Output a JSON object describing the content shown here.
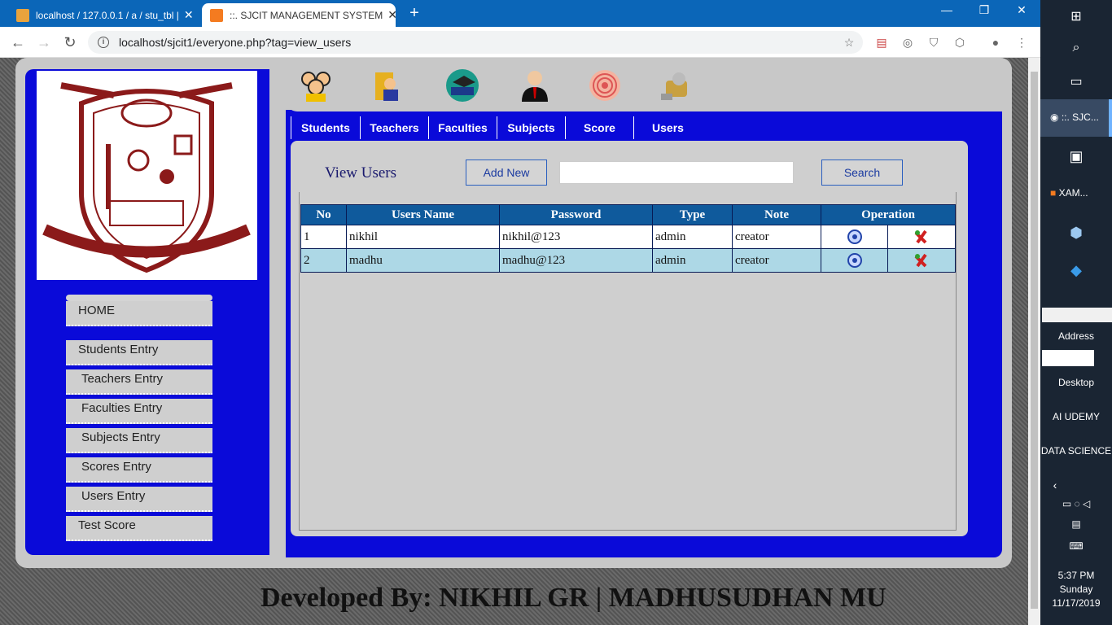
{
  "browser": {
    "tabs": [
      {
        "title": "localhost / 127.0.0.1 / a / stu_tbl |",
        "active": false
      },
      {
        "title": "::. SJCIT MANAGEMENT SYSTEM",
        "active": true
      }
    ],
    "new_tab": "+",
    "url": "localhost/sjcit1/everyone.php?tag=view_users",
    "window_controls": {
      "minimize": "—",
      "restore": "❐",
      "close": "✕"
    },
    "nav": {
      "back": "←",
      "forward": "→",
      "reload": "↻"
    }
  },
  "top_icons": [
    "students-icon",
    "teachers-icon",
    "faculties-icon",
    "subjects-icon",
    "score-icon",
    "users-icon"
  ],
  "nav": [
    "Students",
    "Teachers",
    "Faculties",
    "Subjects",
    "Score",
    "Users"
  ],
  "sidebar": {
    "items": [
      "HOME",
      "Students Entry",
      "Teachers Entry",
      "Faculties Entry",
      "Subjects Entry",
      "Scores Entry",
      "Users Entry",
      "Test Score"
    ]
  },
  "view": {
    "title": "View Users",
    "add_new": "Add New",
    "search_value": "",
    "search_button": "Search"
  },
  "table": {
    "headers": [
      "No",
      "Users Name",
      "Password",
      "Type",
      "Note",
      "Operation"
    ],
    "rows": [
      {
        "no": "1",
        "name": "nikhil",
        "password": "nikhil@123",
        "type": "admin",
        "note": "creator"
      },
      {
        "no": "2",
        "name": "madhu",
        "password": "madhu@123",
        "type": "admin",
        "note": "creator"
      }
    ]
  },
  "footer": "Developed By: NIKHIL GR | MADHUSUDHAN MU",
  "taskbar": {
    "active_app": "::. SJC...",
    "xampp": "XAM...",
    "address_label": "Address",
    "folders": [
      "Desktop",
      "AI UDEMY",
      "DATA SCIENCE"
    ],
    "time": "5:37 PM",
    "day": "Sunday",
    "date": "11/17/2019"
  },
  "colors": {
    "chrome_blue": "#0b66b8",
    "panel_blue": "#0a0ad9",
    "table_header": "#0f5a9c",
    "row_alt": "#add8e6"
  }
}
